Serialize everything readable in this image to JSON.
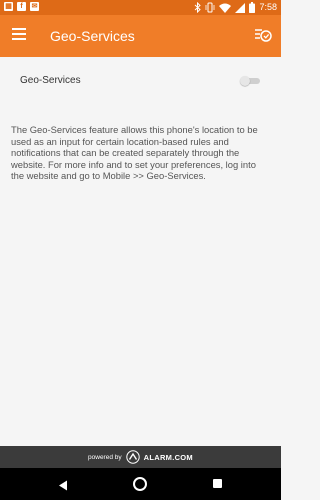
{
  "status_bar": {
    "time": "7:58",
    "left_icons": [
      "calendar-icon",
      "facebook-icon",
      "mail-icon"
    ],
    "right_icons": [
      "bluetooth-icon",
      "vibrate-icon",
      "wifi-icon",
      "signal-icon",
      "battery-icon"
    ]
  },
  "app_bar": {
    "title": "Geo-Services",
    "background": "#f07d28",
    "menu_icon": "hamburger-menu-icon",
    "action_icon": "history-list-icon"
  },
  "geo_services": {
    "label": "Geo-Services",
    "toggle_on": false,
    "description": "The Geo-Services feature allows this phone's location to be used as an input for certain location-based rules and notifications that can be created separately through the website. For more info and to set your preferences, log into the website and go to Mobile >> Geo-Services."
  },
  "footer": {
    "powered_by": "powered by",
    "brand": "ALARM.COM",
    "logo_icon": "alarm-com-logo-icon"
  },
  "nav_bar": {
    "icons": [
      "back-icon",
      "home-icon",
      "recents-icon"
    ]
  }
}
